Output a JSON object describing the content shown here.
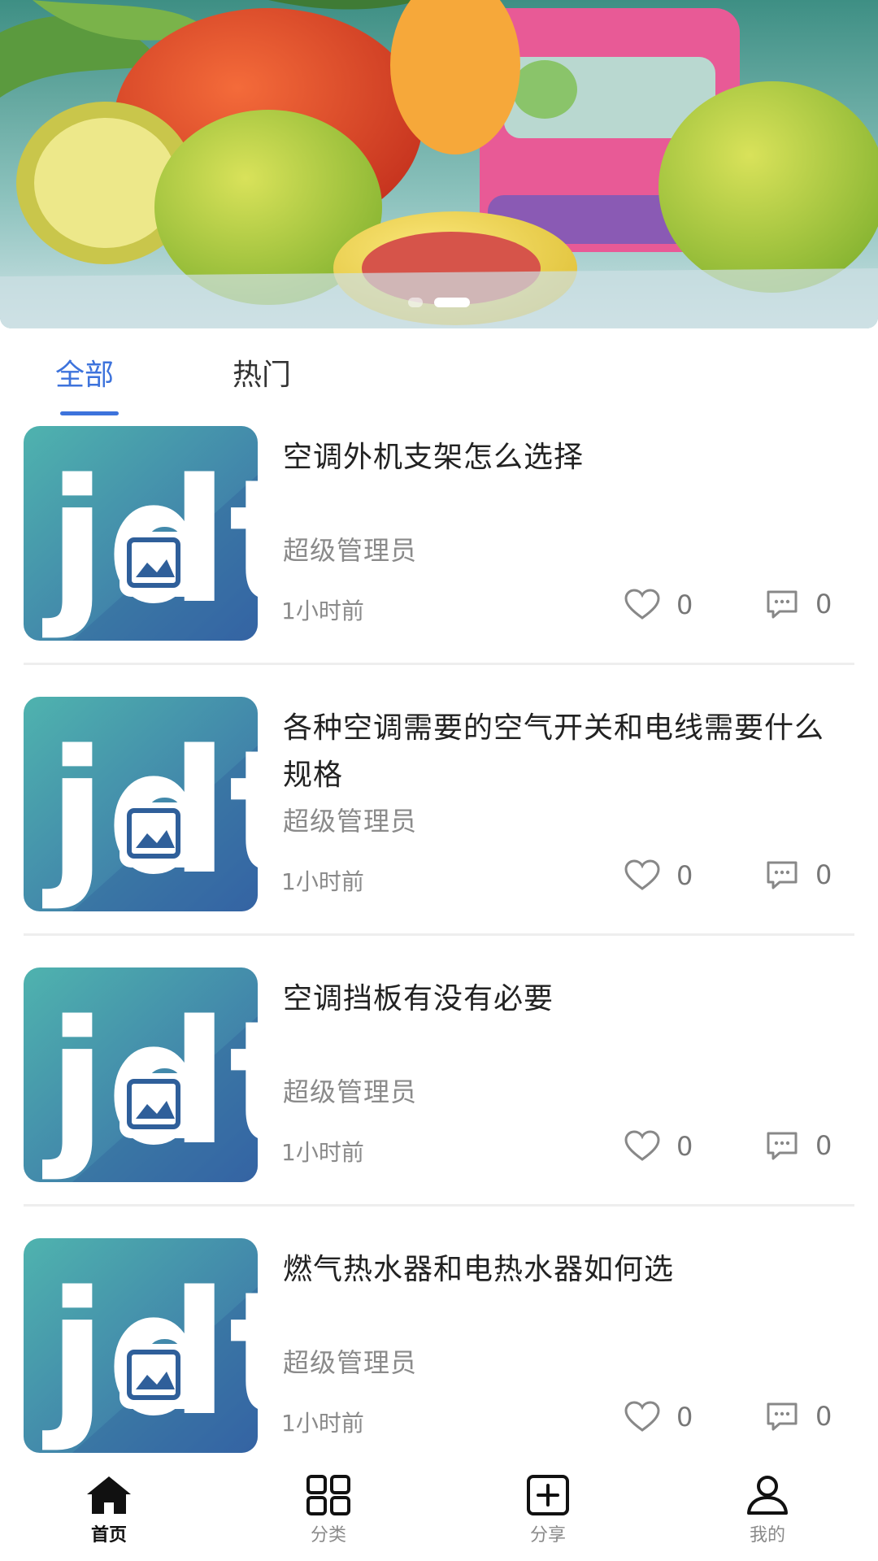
{
  "banner": {
    "slide_count": 2,
    "active_slide": 2
  },
  "tabs": [
    {
      "label": "全部",
      "active": true
    },
    {
      "label": "热门",
      "active": false
    }
  ],
  "articles": [
    {
      "title": "空调外机支架怎么选择",
      "author": "超级管理员",
      "time": "1小时前",
      "likes": "0",
      "comments": "0",
      "thumb_logo": "jdt"
    },
    {
      "title": "各种空调需要的空气开关和电线需要什么规格",
      "author": "超级管理员",
      "time": "1小时前",
      "likes": "0",
      "comments": "0",
      "thumb_logo": "jdt"
    },
    {
      "title": "空调挡板有没有必要",
      "author": "超级管理员",
      "time": "1小时前",
      "likes": "0",
      "comments": "0",
      "thumb_logo": "jdt"
    },
    {
      "title": "燃气热水器和电热水器如何选",
      "author": "超级管理员",
      "time": "1小时前",
      "likes": "0",
      "comments": "0",
      "thumb_logo": "jdt"
    }
  ],
  "bottom_nav": [
    {
      "label": "首页",
      "icon": "home-icon",
      "active": true
    },
    {
      "label": "分类",
      "icon": "grid-icon",
      "active": false
    },
    {
      "label": "分享",
      "icon": "add-square-icon",
      "active": false
    },
    {
      "label": "我的",
      "icon": "user-icon",
      "active": false
    }
  ],
  "colors": {
    "accent": "#3d73dc",
    "title_text": "#222222",
    "meta_text": "#8a8a8a",
    "thumb_teal": "#4aa8a8",
    "thumb_blue": "#3a6fae"
  }
}
